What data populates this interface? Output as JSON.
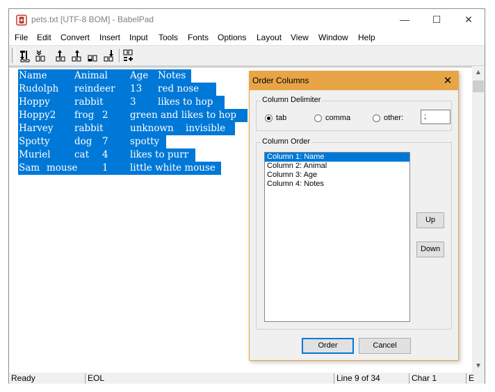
{
  "window": {
    "title": "pets.txt [UTF-8 BOM] - BabelPad",
    "min_glyph": "—",
    "max_glyph": "☐",
    "close_glyph": "✕"
  },
  "menu": [
    "File",
    "Edit",
    "Convert",
    "Insert",
    "Input",
    "Tools",
    "Fonts",
    "Options",
    "Layout",
    "View",
    "Window",
    "Help"
  ],
  "document": {
    "lines": [
      [
        "Name",
        "Animal",
        "Age",
        "Notes"
      ],
      [
        "Rudolph",
        "reindeer",
        "13",
        "red nose"
      ],
      [
        "Hoppy",
        "rabbit",
        "3",
        "likes to hop"
      ],
      [
        "Hoppy2",
        "frog",
        "2",
        "green and likes to hop"
      ],
      [
        "Harvey",
        "rabbit",
        "unknown",
        "invisible"
      ],
      [
        "Spotty",
        "dog",
        "7",
        "spotty"
      ],
      [
        "Muriel",
        "cat",
        "4",
        "likes to purr"
      ],
      [
        "Sam",
        "mouse",
        "1",
        "little white mouse"
      ]
    ]
  },
  "status": {
    "ready": "Ready",
    "eol": "EOL",
    "line": "Line 9 of 34",
    "char": "Char 1",
    "extra": "E"
  },
  "dialog": {
    "title": "Order Columns",
    "close_glyph": "✕",
    "delimiter_group": "Column Delimiter",
    "delimiters": [
      {
        "label": "tab",
        "selected": true
      },
      {
        "label": "comma",
        "selected": false
      },
      {
        "label": "other:",
        "selected": false
      }
    ],
    "other_value": ";",
    "order_group": "Column Order",
    "columns": [
      "Column 1: Name",
      "Column 2: Animal",
      "Column 3: Age",
      "Column 4: Notes"
    ],
    "selected_column": "Column 1: Name",
    "up_label": "Up",
    "down_label": "Down",
    "order_label": "Order",
    "cancel_label": "Cancel"
  },
  "colors": {
    "selection": "#0078d7",
    "dialog_frame": "#e8a547"
  }
}
